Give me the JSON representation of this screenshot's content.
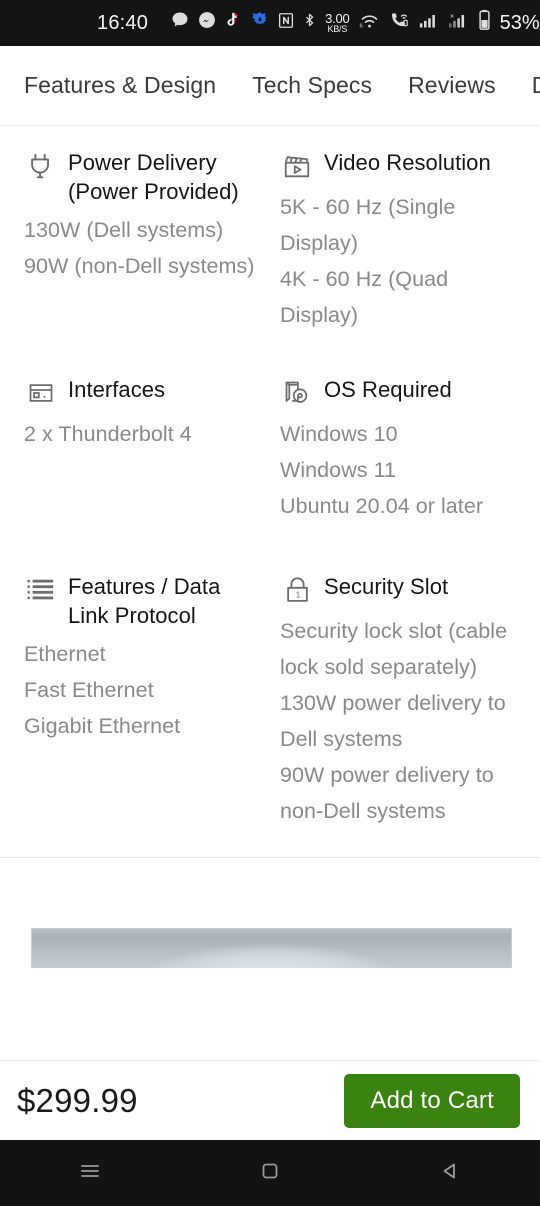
{
  "statusbar": {
    "clock": "16:40",
    "network_speed_value": "3.00",
    "network_speed_unit": "KB/S",
    "battery_percent": "53%",
    "icons": [
      "chat-bubble-icon",
      "messenger-icon",
      "tiktok-icon",
      "brave-icon",
      "nfc-icon",
      "bluetooth-icon",
      "network-speed-indicator",
      "wifi-icon",
      "wifi-calling-icon",
      "signal-sim1-icon",
      "signal-sim2-icon",
      "battery-icon"
    ]
  },
  "tabs": [
    {
      "label": "Features & Design"
    },
    {
      "label": "Tech Specs"
    },
    {
      "label": "Reviews"
    },
    {
      "label": "Drivers,"
    }
  ],
  "specs": [
    {
      "icon": "power-plug-icon",
      "title": "Power Delivery (Power Provided)",
      "values": [
        "130W (Dell systems)",
        "90W (non-Dell systems)"
      ]
    },
    {
      "icon": "video-clapperboard-icon",
      "title": "Video Resolution",
      "values": [
        "5K - 60 Hz (Single Display)",
        "4K - 60 Hz (Quad Display)"
      ]
    },
    {
      "icon": "interfaces-port-icon",
      "title": "Interfaces",
      "values": [
        "2 x Thunderbolt 4"
      ]
    },
    {
      "icon": "os-disc-icon",
      "title": "OS Required",
      "values": [
        "Windows 10",
        "Windows 11",
        "Ubuntu 20.04 or later"
      ]
    },
    {
      "icon": "list-protocol-icon",
      "title": "Features / Data Link Protocol",
      "values": [
        "Ethernet",
        "Fast Ethernet",
        "Gigabit Ethernet"
      ]
    },
    {
      "icon": "lock-icon",
      "title": "Security Slot",
      "values": [
        "Security lock slot (cable lock sold separately)",
        "130W power delivery to Dell systems",
        "90W power delivery to non-Dell systems"
      ]
    }
  ],
  "buybar": {
    "price": "$299.99",
    "add_to_cart_label": "Add to Cart",
    "accent_color": "#3a8311"
  },
  "navbar": {
    "buttons": [
      "menu-icon",
      "home-square-icon",
      "back-triangle-icon"
    ]
  }
}
